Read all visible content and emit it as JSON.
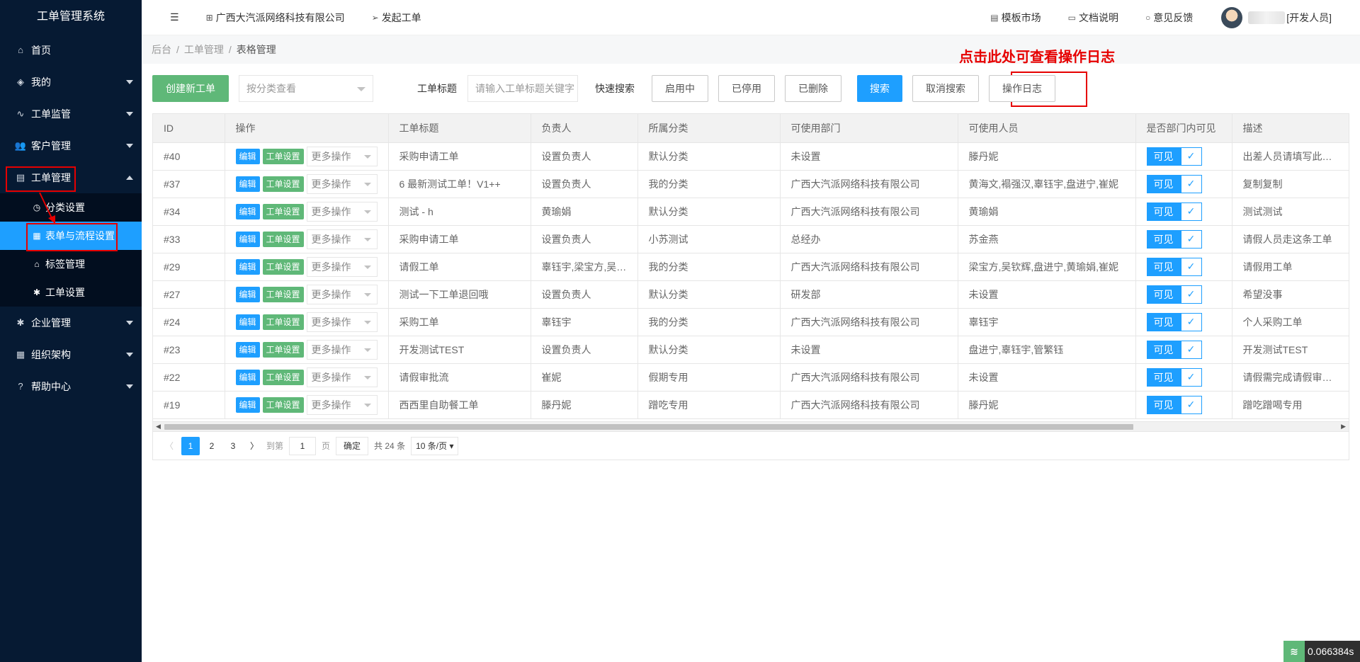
{
  "app": {
    "title": "工单管理系统"
  },
  "sidebar": {
    "items": [
      {
        "label": "首页",
        "icon": "home-icon",
        "glyph": "⌂"
      },
      {
        "label": "我的",
        "icon": "layers-icon",
        "glyph": "◈"
      },
      {
        "label": "工单监管",
        "icon": "pulse-icon",
        "glyph": "∿"
      },
      {
        "label": "客户管理",
        "icon": "users-icon",
        "glyph": "👥"
      },
      {
        "label": "工单管理",
        "icon": "clipboard-icon",
        "glyph": "▤"
      },
      {
        "label": "企业管理",
        "icon": "gear-icon",
        "glyph": "✱"
      },
      {
        "label": "组织架构",
        "icon": "calendar-icon",
        "glyph": "▦"
      },
      {
        "label": "帮助中心",
        "icon": "question-icon",
        "glyph": "?"
      }
    ],
    "sub_items": [
      {
        "label": "分类设置",
        "icon": "clock-icon",
        "glyph": "◷"
      },
      {
        "label": "表单与流程设置",
        "icon": "table-icon",
        "glyph": "▦"
      },
      {
        "label": "标签管理",
        "icon": "tag-icon",
        "glyph": "⌂"
      },
      {
        "label": "工单设置",
        "icon": "gear-icon",
        "glyph": "✱"
      }
    ]
  },
  "header": {
    "menu_toggle_glyph": "☰",
    "company": "广西大汽派网络科技有限公司",
    "new_ticket": "发起工单",
    "template_market": "模板市场",
    "docs": "文档说明",
    "feedback": "意见反馈",
    "role": "[开发人员]"
  },
  "breadcrumb": {
    "items": [
      "后台",
      "工单管理",
      "表格管理"
    ]
  },
  "annotation": "点击此处可查看操作日志",
  "toolbar": {
    "create": "创建新工单",
    "category_placeholder": "按分类查看",
    "title_label": "工单标题",
    "title_placeholder": "请输入工单标题关键字",
    "quick_label": "快速搜索",
    "enabled": "启用中",
    "disabled": "已停用",
    "deleted": "已删除",
    "search": "搜索",
    "cancel_search": "取消搜索",
    "log": "操作日志"
  },
  "table": {
    "columns": [
      "ID",
      "操作",
      "工单标题",
      "负责人",
      "所属分类",
      "可使用部门",
      "可使用人员",
      "是否部门内可见",
      "描述"
    ],
    "action_labels": {
      "edit": "编辑",
      "settings": "工单设置",
      "more": "更多操作",
      "visible": "可见"
    },
    "rows": [
      {
        "id": "#40",
        "title": "采购申请工单",
        "owner": "设置负责人",
        "category": "默认分类",
        "dept": "未设置",
        "users": "滕丹妮",
        "desc": "出差人员请填写此申请"
      },
      {
        "id": "#37",
        "title": "6 最新测试工单！V1++",
        "owner": "设置负责人",
        "category": "我的分类",
        "dept": "广西大汽派网络科技有限公司",
        "users": "黄海文,褟强汉,辜钰宇,盘进宁,崔妮",
        "desc": "复制复制"
      },
      {
        "id": "#34",
        "title": "测试 - h",
        "owner": "黄瑜娟",
        "category": "默认分类",
        "dept": "广西大汽派网络科技有限公司",
        "users": "黄瑜娟",
        "desc": "测试测试"
      },
      {
        "id": "#33",
        "title": "采购申请工单",
        "owner": "设置负责人",
        "category": "小苏测试",
        "dept": "总经办",
        "users": "苏金燕",
        "desc": "请假人员走这条工单"
      },
      {
        "id": "#29",
        "title": "请假工单",
        "owner": "辜钰宇,梁宝方,吴钦辉",
        "category": "我的分类",
        "dept": "广西大汽派网络科技有限公司",
        "users": "梁宝方,吴钦辉,盘进宁,黄瑜娟,崔妮",
        "desc": "请假用工单"
      },
      {
        "id": "#27",
        "title": "测试一下工单退回哦",
        "owner": "设置负责人",
        "category": "默认分类",
        "dept": "研发部",
        "users": "未设置",
        "desc": "希望没事"
      },
      {
        "id": "#24",
        "title": "采购工单",
        "owner": "辜钰宇",
        "category": "我的分类",
        "dept": "广西大汽派网络科技有限公司",
        "users": "辜钰宇",
        "desc": "个人采购工单"
      },
      {
        "id": "#23",
        "title": "开发测试TEST",
        "owner": "设置负责人",
        "category": "默认分类",
        "dept": "未设置",
        "users": "盘进宁,辜钰宇,管繁钰",
        "desc": "开发测试TEST"
      },
      {
        "id": "#22",
        "title": "请假审批流",
        "owner": "崔妮",
        "category": "假期专用",
        "dept": "广西大汽派网络科技有限公司",
        "users": "未设置",
        "desc": "请假需完成请假审批流。"
      },
      {
        "id": "#19",
        "title": "西西里自助餐工单",
        "owner": "滕丹妮",
        "category": "蹭吃专用",
        "dept": "广西大汽派网络科技有限公司",
        "users": "滕丹妮",
        "desc": "蹭吃蹭喝专用"
      }
    ]
  },
  "pager": {
    "pages": [
      "1",
      "2",
      "3"
    ],
    "goto": "到第",
    "current": "1",
    "page_unit": "页",
    "confirm": "确定",
    "total": "共 24 条",
    "per_page": "10 条/页"
  },
  "timer": "0.066384s"
}
